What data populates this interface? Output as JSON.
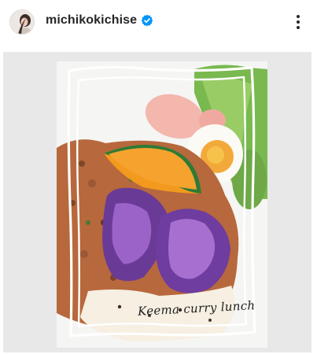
{
  "header": {
    "username": "michikokichise",
    "verified_icon": "verified-badge-icon",
    "more_icon": "more-vertical-icon"
  },
  "post": {
    "image_caption": "Keema curry lunch"
  },
  "colors": {
    "username": "#262626",
    "verified": "#0095f6",
    "image_background": "#e8e8e8"
  }
}
